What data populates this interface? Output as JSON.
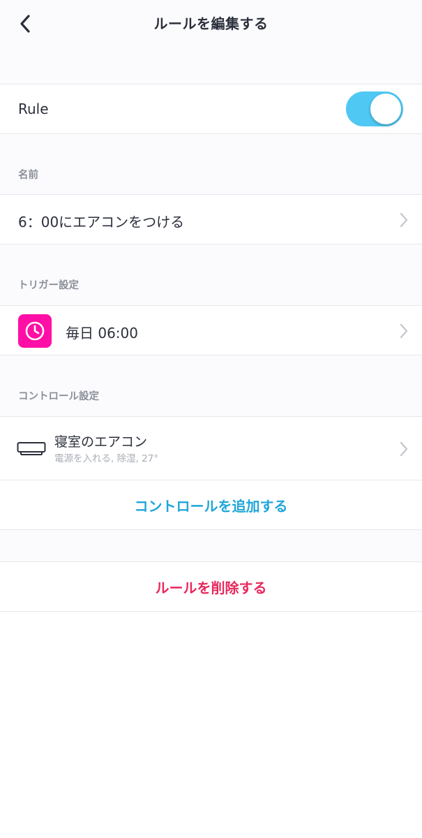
{
  "header": {
    "title": "ルールを編集する",
    "back_icon": "chevron-left-icon"
  },
  "rule_toggle": {
    "label": "Rule",
    "enabled": true,
    "on_color": "#4fc8f3"
  },
  "name_section": {
    "label": "名前",
    "value": "6：00にエアコンをつける"
  },
  "trigger_section": {
    "label": "トリガー設定",
    "item": {
      "icon": "clock-icon",
      "icon_bg_color": "#ff0fa6",
      "text": "毎日 06:00"
    }
  },
  "control_section": {
    "label": "コントロール設定",
    "item": {
      "icon": "air-conditioner-icon",
      "title": "寝室のエアコン",
      "subtitle": "電源を入れる, 除湿, 27°"
    },
    "add_label": "コントロールを追加する",
    "add_color": "#1fa6d9"
  },
  "delete": {
    "label": "ルールを削除する",
    "color": "#e8285c"
  }
}
